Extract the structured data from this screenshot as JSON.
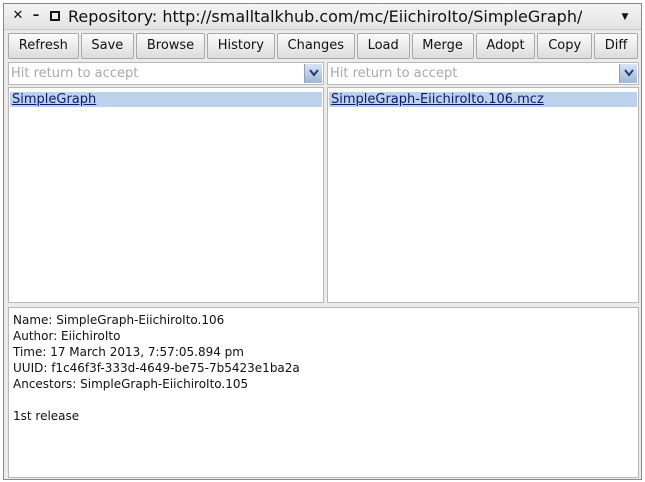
{
  "window": {
    "title": "Repository: http://smalltalkhub.com/mc/EiichiroIto/SimpleGraph/m"
  },
  "toolbar": {
    "buttons": [
      "Refresh",
      "Save",
      "Browse",
      "History",
      "Changes",
      "Load",
      "Merge",
      "Adopt",
      "Copy",
      "Diff"
    ]
  },
  "packages": {
    "filter_placeholder": "Hit return to accept",
    "items": [
      "SimpleGraph"
    ]
  },
  "versions": {
    "filter_placeholder": "Hit return to accept",
    "items": [
      "SimpleGraph-EiichiroIto.106.mcz"
    ]
  },
  "details": {
    "name": "Name: SimpleGraph-EiichiroIto.106",
    "author": "Author: EiichiroIto",
    "time": "Time: 17 March 2013, 7:57:05.894 pm",
    "uuid": "UUID: f1c46f3f-333d-4649-be75-7b5423e1ba2a",
    "ancestors": "Ancestors: SimpleGraph-EiichiroIto.105",
    "message": "1st release"
  },
  "icons": {
    "close": "close-icon",
    "minimize": "minimize-icon",
    "maximize": "maximize-icon",
    "menu": "chevron-down-icon"
  }
}
